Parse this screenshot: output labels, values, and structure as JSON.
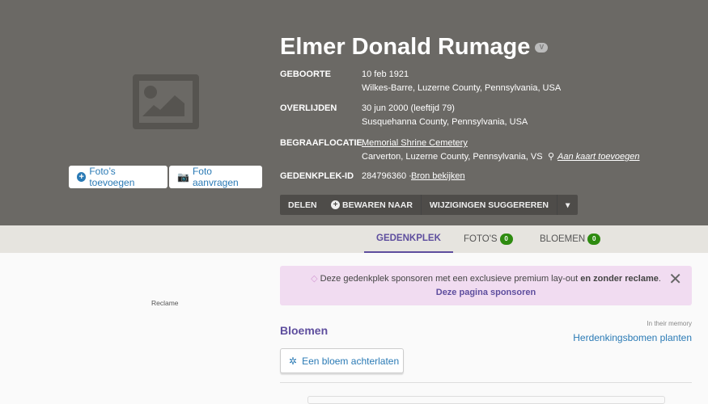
{
  "person": {
    "name": "Elmer Donald Rumage",
    "verified_badge": "V"
  },
  "facts": [
    {
      "label": "GEBOORTE",
      "line1": "10 feb 1921",
      "line2": "Wilkes-Barre, Luzerne County, Pennsylvania, USA"
    },
    {
      "label": "OVERLIJDEN",
      "line1": "30 jun 2000 (leeftijd 79)",
      "line2": "Susquehanna County, Pennsylvania, USA"
    },
    {
      "label": "BEGRAAFLOCATIE",
      "line1": "Memorial Shrine Cemetery",
      "line2": "Carverton, Luzerne County, Pennsylvania, VS",
      "map_link": "Aan kaart toevoegen"
    },
    {
      "label": "GEDENKPLEK-ID",
      "id": "284796360 ·",
      "source_link": "Bron bekijken"
    }
  ],
  "photo_buttons": {
    "add": "Foto’s toevoegen",
    "request": "Foto aanvragen"
  },
  "actions": {
    "share": "DELEN",
    "save": "BEWAREN NAAR",
    "suggest": "WIJZIGINGEN SUGGEREREN"
  },
  "tabs": [
    {
      "label": "GEDENKPLEK"
    },
    {
      "label": "FOTO'S",
      "count": "0"
    },
    {
      "label": "BLOEMEN",
      "count": "0"
    }
  ],
  "ad_label": "Reclame",
  "sponsor": {
    "text": "Deze gedenkplek sponsoren met een exclusieve premium lay-out",
    "bold": "en zonder reclame",
    "link": "Deze pagina sponsoren"
  },
  "flowers": {
    "title": "Bloemen",
    "memory_label": "In their memory",
    "trees_link": "Herdenkingsbomen planten",
    "leave_button": "Een bloem achterlaten"
  }
}
